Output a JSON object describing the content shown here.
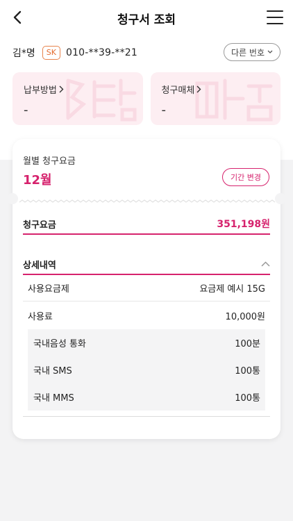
{
  "header": {
    "title": "청구서 조회"
  },
  "user": {
    "name": "김*명",
    "carrier": "SK",
    "phone": "010-**39-**21",
    "other_number_label": "다른 번호"
  },
  "info_cards": [
    {
      "label": "납부방법",
      "value": "-"
    },
    {
      "label": "청구매체",
      "value": "-"
    }
  ],
  "bill": {
    "month_label": "월별 청구요금",
    "month_value": "12월",
    "period_button": "기간 변경",
    "total_label": "청구요금",
    "total_value": "351,198원",
    "detail_title": "상세내역",
    "items": [
      {
        "label": "사용요금제",
        "value": "요금제 예시 15G"
      },
      {
        "label": "사용료",
        "value": "10,000원"
      }
    ],
    "sub_items": [
      {
        "label": "국내음성 통화",
        "value": "100분"
      },
      {
        "label": "국내 SMS",
        "value": "100통"
      },
      {
        "label": "국내 MMS",
        "value": "100통"
      }
    ]
  },
  "colors": {
    "accent": "#d6226d",
    "card_bg": "#fdeef2",
    "page_bg": "#f3f3f4",
    "carrier_badge": "#e46b2e"
  }
}
